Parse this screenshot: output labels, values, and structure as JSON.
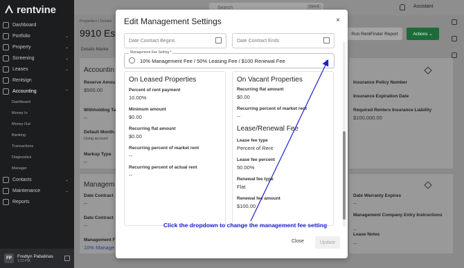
{
  "app": {
    "brand": "rentvine"
  },
  "sidebar": {
    "items": [
      {
        "label": "Dashboard",
        "chev": ""
      },
      {
        "label": "Portfolio",
        "chev": "⌄"
      },
      {
        "label": "Property",
        "chev": "⌄"
      },
      {
        "label": "Screening",
        "chev": "⌄"
      },
      {
        "label": "Leases",
        "chev": "⌄"
      },
      {
        "label": "Rentsign",
        "chev": ""
      },
      {
        "label": "Accounting",
        "chev": "⌃"
      }
    ],
    "accounting_sub": [
      "Dashboard",
      "Money In",
      "Money Out",
      "Banking",
      "Transactions",
      "Diagnostics",
      "Manager"
    ],
    "items_after": [
      {
        "label": "Contacts",
        "chev": "⌄"
      },
      {
        "label": "Maintenance",
        "chev": "⌄"
      },
      {
        "label": "Reports",
        "chev": ""
      }
    ],
    "user": {
      "initials": "FP",
      "name": "Fredlyn Pabalinas",
      "time": "1:23 PM"
    }
  },
  "topbar": {
    "search_placeholder": "Search",
    "search_shortcut": "Ctrl+K",
    "assistant": "Assistant"
  },
  "page": {
    "breadcrumb": "Properties  /  Details",
    "title": "9910 Este",
    "tabs": "Details    Marke",
    "run_rentfinder": "Run RentFinder Report",
    "actions": "Actions  ⌄"
  },
  "background": {
    "accounting_title": "Accountin",
    "reserve_label": "Reserve Amou",
    "reserve_value": "$500.00",
    "withholding_label": "Withholding Ta",
    "withholding_value": "--",
    "default_month_label": "Default Month-",
    "default_month_note": "Using account",
    "markup_label": "Markup Type",
    "markup_value": "--",
    "management_title": "Managem",
    "date_contract_label_1": "Date Contract",
    "date_contract_value_1": "--",
    "date_contract_label_2": "Date Contract",
    "date_contract_value_2": "--",
    "management_fee_label": "Management F",
    "management_fee_value": "10% Manage",
    "insurance_policy_label": "Insurance Policy Number",
    "insurance_expiration_label": "Insurance Expiration Date",
    "renters_liability_label": "Required Renters Insurance Liability",
    "renters_liability_value": "$100,000.00",
    "warranty_label": "Date Warranty Expires",
    "warranty_value": "--",
    "mgmt_entry_label": "Management Company Entry Instructions",
    "mgmt_entry_value": "--",
    "lease_notes_label": "Lease Notes",
    "lease_notes_value": "--"
  },
  "modal": {
    "title": "Edit Management Settings",
    "close_icon": "×",
    "date_begins_placeholder": "Date Contract Begins",
    "date_ends_placeholder": "Date Contract Ends",
    "fee_setting_legend": "Management Fee Setting *",
    "fee_setting_value": "10% Management Fee / 50% Leasing Fee / $100 Renewal Fee",
    "leased": {
      "title": "On Leased Properties",
      "fields": [
        {
          "label": "Percent of rent payment",
          "value": "10.00%"
        },
        {
          "label": "Minimum amount",
          "value": "$0.00"
        },
        {
          "label": "Recurring flat amount",
          "value": "$0.00"
        },
        {
          "label": "Recurring percent of market rent",
          "value": "--"
        },
        {
          "label": "Recurring percent of actual rent",
          "value": "--"
        }
      ]
    },
    "vacant": {
      "title": "On Vacant Properties",
      "fields": [
        {
          "label": "Recurring flat amount",
          "value": "$0.00"
        },
        {
          "label": "Recurring percent of market rent",
          "value": "--"
        }
      ]
    },
    "lease_renewal": {
      "title": "Lease/Renewal Fee",
      "fields": [
        {
          "label": "Lease fee type",
          "value": "Percent of Rent"
        },
        {
          "label": "Lease fee percent",
          "value": "50.00%"
        },
        {
          "label": "Renewal fee type",
          "value": "Flat"
        },
        {
          "label": "Renewal fee amount",
          "value": "$100.00"
        }
      ]
    },
    "close_label": "Close",
    "update_label": "Update"
  },
  "annotation": {
    "text": "Click the dropdown to change the management fee setting",
    "color": "#1f1fcf"
  }
}
